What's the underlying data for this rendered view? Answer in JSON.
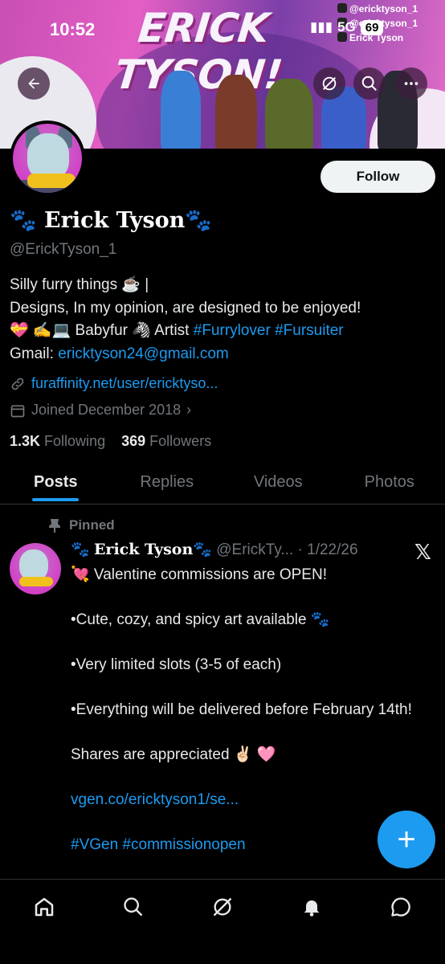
{
  "status_bar": {
    "time": "10:52",
    "network": "5G",
    "battery": "69"
  },
  "banner": {
    "title": "ERICK TYSON!",
    "social": [
      "@ericktyson_1",
      "@ericktyson_1",
      "Erick Tyson"
    ]
  },
  "profile": {
    "follow_label": "Follow",
    "name": "Erick Tyson",
    "name_prefix": "🐾",
    "name_suffix": "🐾",
    "handle": "@ErickTyson_1",
    "bio_line1": "Silly furry things ☕️ |",
    "bio_line2": "Designs, In my opinion, are designed to be enjoyed!",
    "bio_line3_text": "💝 ✍️💻 Babyfur 🦓 Artist",
    "hashtag1": "#Furrylover",
    "hashtag2": "#Fursuiter",
    "gmail_label": "Gmail:",
    "gmail": "ericktyson24@gmail.com",
    "website": "furaffinity.net/user/ericktyso...",
    "joined": "Joined December 2018",
    "following_count": "1.3K",
    "following_label": "Following",
    "followers_count": "369",
    "followers_label": "Followers"
  },
  "tabs": [
    "Posts",
    "Replies",
    "Videos",
    "Photos"
  ],
  "post": {
    "pinned_label": "Pinned",
    "author_name": "Erick Tyson",
    "author_prefix": "🐾",
    "author_suffix": "🐾",
    "author_handle": "@ErickTy...",
    "date": "· 1/22/26",
    "lines": [
      "💘 Valentine commissions are OPEN!",
      "•Cute, cozy, and spicy art available 🐾",
      "•Very limited slots (3-5 of each)",
      "•Everything will be delivered before February 14th!",
      "Shares are appreciated ✌🏻 🩷"
    ],
    "link": "vgen.co/ericktyson1/se...",
    "hashtags": "#VGen #commissionopen"
  },
  "fab_label": "+",
  "nav": [
    "home-icon",
    "search-icon",
    "grok-icon",
    "notifications-icon",
    "messages-icon"
  ],
  "colors": {
    "accent": "#1d9bf0",
    "background": "#000000",
    "muted": "#71767b"
  }
}
